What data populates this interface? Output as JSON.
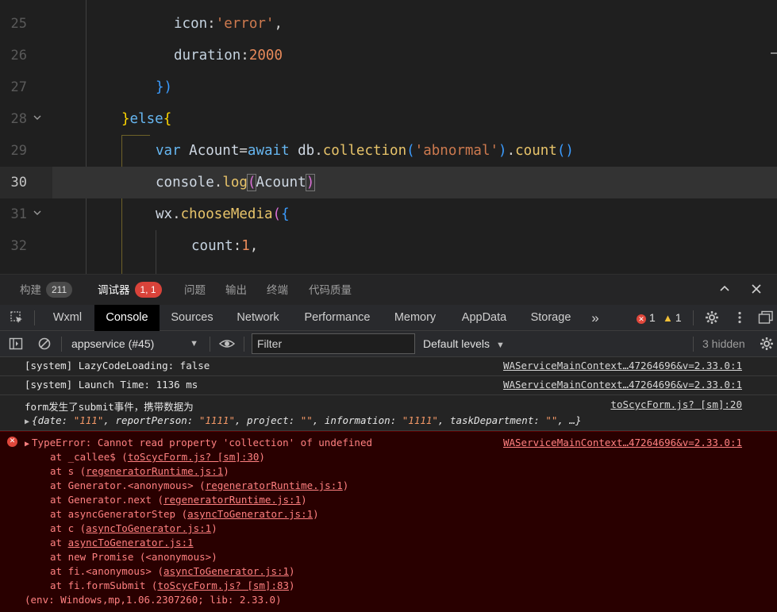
{
  "editor": {
    "lines": [
      {
        "no": "25",
        "tokens": [
          [
            "tok-key",
            "icon"
          ],
          [
            "tok-pun",
            ":"
          ],
          [
            "tok-str",
            "'error'"
          ],
          [
            "tok-pun",
            ","
          ]
        ]
      },
      {
        "no": "26",
        "tokens": [
          [
            "tok-key",
            "duration"
          ],
          [
            "tok-pun",
            ":"
          ],
          [
            "tok-num",
            "2000"
          ]
        ]
      },
      {
        "no": "27",
        "tokens": [
          [
            "tok-br3",
            "})"
          ]
        ]
      },
      {
        "no": "28",
        "tokens": [
          [
            "tok-br1",
            "}"
          ],
          [
            "tok-kw",
            "else"
          ],
          [
            "tok-br1",
            "{"
          ]
        ]
      },
      {
        "no": "29",
        "tokens": [
          [
            "tok-kw",
            "var "
          ],
          [
            "tok-var",
            "Acount"
          ],
          [
            "tok-pun",
            "="
          ],
          [
            "tok-kw",
            "await "
          ],
          [
            "tok-var",
            "db"
          ],
          [
            "tok-pun",
            "."
          ],
          [
            "tok-fn",
            "collection"
          ],
          [
            "tok-br3",
            "("
          ],
          [
            "tok-str",
            "'abnormal'"
          ],
          [
            "tok-br3",
            ")"
          ],
          [
            "tok-pun",
            "."
          ],
          [
            "tok-fn",
            "count"
          ],
          [
            "tok-br3",
            "()"
          ]
        ]
      },
      {
        "no": "30",
        "tokens": [
          [
            "tok-var",
            "console"
          ],
          [
            "tok-pun",
            "."
          ],
          [
            "tok-fn",
            "log"
          ],
          [
            "tok-br2",
            "("
          ],
          [
            "tok-var",
            "Acount"
          ],
          [
            "tok-br2",
            ")"
          ]
        ]
      },
      {
        "no": "31",
        "tokens": [
          [
            "tok-var",
            "wx"
          ],
          [
            "tok-pun",
            "."
          ],
          [
            "tok-fn",
            "chooseMedia"
          ],
          [
            "tok-br2",
            "("
          ],
          [
            "tok-br3",
            "{"
          ]
        ]
      },
      {
        "no": "32",
        "tokens": [
          [
            "tok-key",
            "count"
          ],
          [
            "tok-pun",
            ":"
          ],
          [
            "tok-num",
            "1"
          ],
          [
            "tok-pun",
            ","
          ]
        ]
      }
    ]
  },
  "panel": {
    "tabs": [
      {
        "label": "构建",
        "badge": "211"
      },
      {
        "label": "调试器",
        "badge": "1, 1"
      },
      {
        "label": "问题"
      },
      {
        "label": "输出"
      },
      {
        "label": "终端"
      },
      {
        "label": "代码质量"
      }
    ]
  },
  "devtools": {
    "tabs": [
      "Wxml",
      "Console",
      "Sources",
      "Network",
      "Performance",
      "Memory",
      "AppData",
      "Storage"
    ],
    "more": "»",
    "error_count": "1",
    "warning_count": "1"
  },
  "console_toolbar": {
    "context": "appservice (#45)",
    "filter_placeholder": "Filter",
    "levels": "Default levels",
    "hidden": "3 hidden"
  },
  "console": {
    "messages": [
      {
        "text": "[system] LazyCodeLoading: false",
        "source": "WAServiceMainContext…47264696&v=2.33.0:1"
      },
      {
        "text": "[system] Launch Time: 1136 ms",
        "source": "WAServiceMainContext…47264696&v=2.33.0:1"
      },
      {
        "text": "form发生了submit事件，携带数据为",
        "source": "toScycForm.js? [sm]:20"
      }
    ],
    "object_preview": {
      "open": "{",
      "items": [
        {
          "key": "date",
          "value": "\"111\""
        },
        {
          "key": "reportPerson",
          "value": "\"1111\""
        },
        {
          "key": "project",
          "value": "\"\""
        },
        {
          "key": "information",
          "value": "\"1111\""
        },
        {
          "key": "taskDepartment",
          "value": "\"\""
        }
      ],
      "tail": ", …}"
    },
    "error": {
      "message": "TypeError: Cannot read property 'collection' of undefined",
      "source": "WAServiceMainContext…47264696&v=2.33.0:1",
      "stack": [
        {
          "pre": "at _callee$ (",
          "link": "toScycForm.js? [sm]:30",
          "post": ")"
        },
        {
          "pre": "at s (",
          "link": "regeneratorRuntime.js:1",
          "post": ")"
        },
        {
          "pre": "at Generator.<anonymous> (",
          "link": "regeneratorRuntime.js:1",
          "post": ")"
        },
        {
          "pre": "at Generator.next (",
          "link": "regeneratorRuntime.js:1",
          "post": ")"
        },
        {
          "pre": "at asyncGeneratorStep (",
          "link": "asyncToGenerator.js:1",
          "post": ")"
        },
        {
          "pre": "at c (",
          "link": "asyncToGenerator.js:1",
          "post": ")"
        },
        {
          "pre": "at ",
          "link": "asyncToGenerator.js:1",
          "post": ""
        },
        {
          "pre": "at new Promise (<anonymous>)",
          "link": "",
          "post": ""
        },
        {
          "pre": "at fi.<anonymous> (",
          "link": "asyncToGenerator.js:1",
          "post": ")"
        },
        {
          "pre": "at fi.formSubmit (",
          "link": "toScycForm.js? [sm]:83",
          "post": ")"
        }
      ],
      "env": "(env: Windows,mp,1.06.2307260; lib: 2.33.0)"
    }
  }
}
